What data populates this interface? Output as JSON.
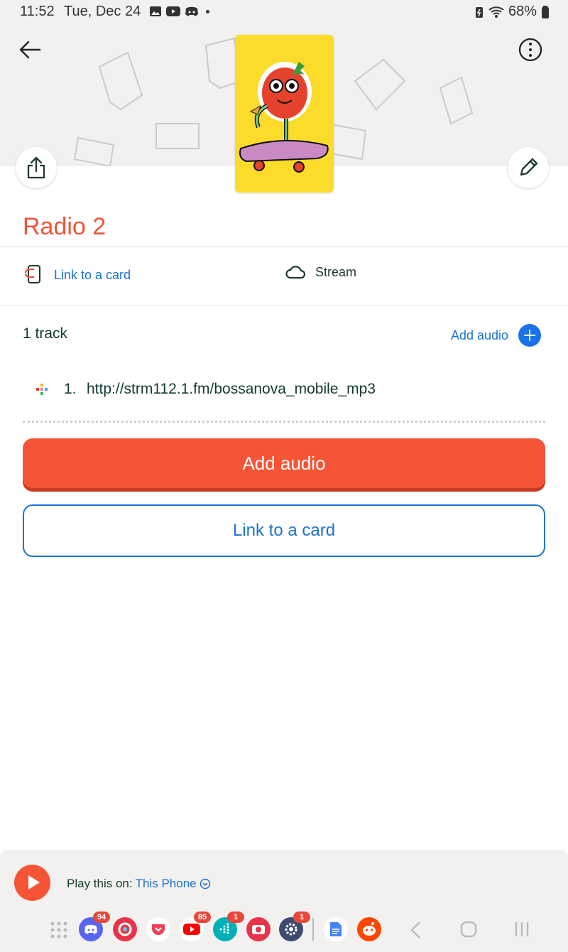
{
  "status": {
    "time": "11:52",
    "date": "Tue, Dec 24",
    "battery": "68%"
  },
  "playlist": {
    "title": "Radio 2",
    "link_card_label": "Link to a card",
    "stream_label": "Stream",
    "track_count": "1 track",
    "add_audio_link": "Add audio",
    "tracks": [
      {
        "num": "1.",
        "url": "http://strm112.1.fm/bossanova_mobile_mp3"
      }
    ],
    "add_audio_button": "Add audio",
    "link_card_button": "Link to a card"
  },
  "player": {
    "play_on_label": "Play this on:",
    "device": "This Phone"
  },
  "dock": {
    "badges": {
      "discord": "94",
      "youtube": "85",
      "fitbit": "1",
      "settings": "1"
    }
  },
  "colors": {
    "accent": "#f55436",
    "link": "#1a73d1",
    "text": "#123c2a",
    "header_bg": "#f3f1f0"
  }
}
